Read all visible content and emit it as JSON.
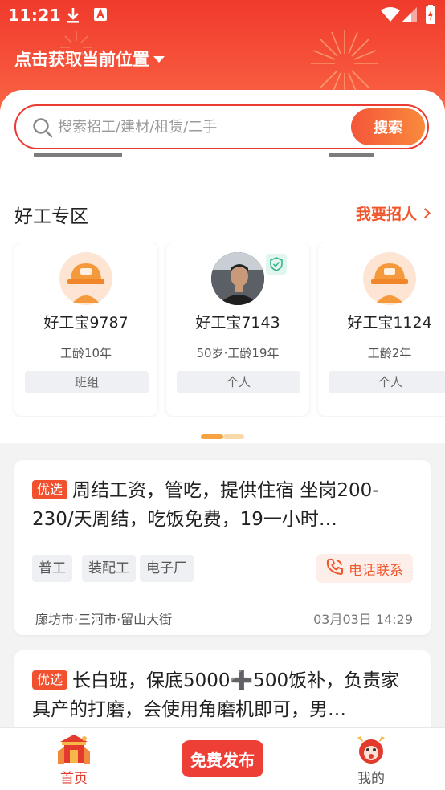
{
  "status_bar": {
    "time": "11:21"
  },
  "header": {
    "location_label": "点击获取当前位置"
  },
  "search": {
    "placeholder": "搜索招工/建材/租赁/二手",
    "button_label": "搜索"
  },
  "section": {
    "title": "好工专区",
    "link_label": "我要招人"
  },
  "workers": [
    {
      "name": "好工宝9787",
      "meta": "工龄10年",
      "tag": "班组",
      "verified": false
    },
    {
      "name": "好工宝7143",
      "meta": "50岁·工龄19年",
      "tag": "个人",
      "verified": true
    },
    {
      "name": "好工宝1124",
      "meta": "工龄2年",
      "tag": "个人",
      "verified": false
    }
  ],
  "jobs": [
    {
      "badge": "优选",
      "title": "周结工资，管吃，提供住宿 坐岗200-230/天周结，吃饭免费，19一小时…",
      "tags": [
        "普工",
        "装配工",
        "电子厂"
      ],
      "call_label": "电话联系",
      "location": "廊坊市·三河市·留山大街",
      "time": "03月03日 14:29"
    },
    {
      "badge": "优选",
      "title": "长白班，保底5000➕500饭补，负责家具产的打磨，会使用角磨机即可，男…"
    }
  ],
  "bottom_nav": {
    "home_label": "首页",
    "publish_label": "免费发布",
    "mine_label": "我的"
  },
  "colors": {
    "accent": "#f0562c",
    "header": "#f03a2c",
    "badge": "#f1512e",
    "publish": "#ee3f37"
  }
}
